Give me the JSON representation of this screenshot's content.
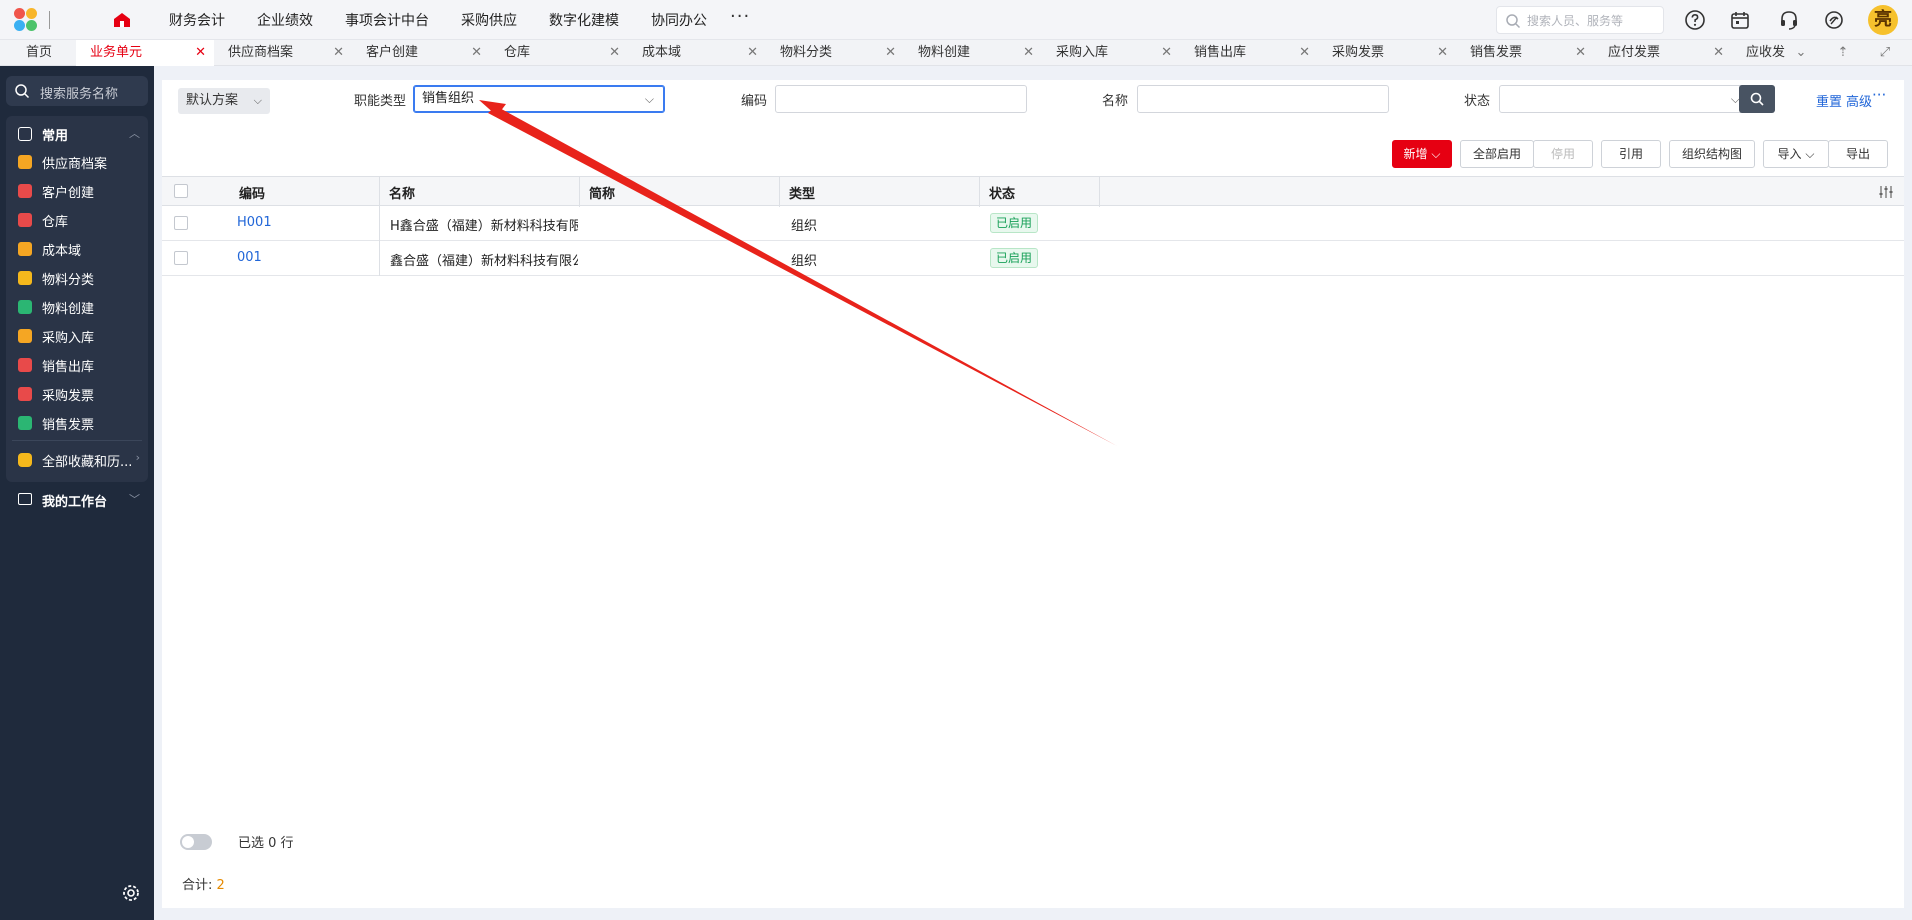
{
  "topnav": {
    "items": [
      "财务会计",
      "企业绩效",
      "事项会计中台",
      "采购供应",
      "数字化建模",
      "协同办公"
    ],
    "more": "···",
    "search_placeholder": "搜索人员、服务等",
    "avatar_text": "亮"
  },
  "tabs": [
    "首页",
    "业务单元",
    "供应商档案",
    "客户创建",
    "仓库",
    "成本域",
    "物料分类",
    "物料创建",
    "采购入库",
    "销售出库",
    "采购发票",
    "销售发票",
    "应付发票",
    "应收发"
  ],
  "active_tab_index": 1,
  "sidebar": {
    "search_placeholder": "搜索服务名称",
    "group_label": "常用",
    "items": [
      {
        "label": "供应商档案",
        "icon": "supplier-icon",
        "color": "#f5a623"
      },
      {
        "label": "客户创建",
        "icon": "customer-icon",
        "color": "#e84a4a"
      },
      {
        "label": "仓库",
        "icon": "warehouse-icon",
        "color": "#e84a4a"
      },
      {
        "label": "成本域",
        "icon": "cost-icon",
        "color": "#f5a623"
      },
      {
        "label": "物料分类",
        "icon": "category-icon",
        "color": "#f5b81c"
      },
      {
        "label": "物料创建",
        "icon": "material-icon",
        "color": "#2bb673"
      },
      {
        "label": "采购入库",
        "icon": "purchase-in-icon",
        "color": "#f5a623"
      },
      {
        "label": "销售出库",
        "icon": "sales-out-icon",
        "color": "#e84a4a"
      },
      {
        "label": "采购发票",
        "icon": "purchase-invoice-icon",
        "color": "#e84a4a"
      },
      {
        "label": "销售发票",
        "icon": "sales-invoice-icon",
        "color": "#2bb673"
      }
    ],
    "all_favorites": "全部收藏和历...",
    "workbench": "我的工作台"
  },
  "filters": {
    "scheme": "默认方案",
    "function_type_label": "职能类型",
    "function_type_value": "销售组织",
    "code_label": "编码",
    "name_label": "名称",
    "status_label": "状态",
    "reset": "重置",
    "advanced": "高级",
    "more": "···"
  },
  "toolbar": {
    "add": "新增",
    "enable_all": "全部启用",
    "disable": "停用",
    "reference": "引用",
    "org_chart": "组织结构图",
    "import": "导入",
    "export": "导出"
  },
  "table": {
    "columns": [
      "编码",
      "名称",
      "简称",
      "类型",
      "状态"
    ],
    "rows": [
      {
        "code": "H001",
        "name": "H鑫合盛（福建）新材料科技有限",
        "short": "",
        "type": "组织",
        "status": "已启用"
      },
      {
        "code": "001",
        "name": "鑫合盛（福建）新材料科技有限公",
        "short": "",
        "type": "组织",
        "status": "已启用"
      }
    ]
  },
  "footer": {
    "selected": "已选 0 行",
    "total_label": "合计:",
    "total_value": "2"
  },
  "colors": {
    "accent": "#e60012",
    "sidebar_bg": "#1f2a3c",
    "link": "#2166d8",
    "annotation_arrow": "#e8231b"
  }
}
